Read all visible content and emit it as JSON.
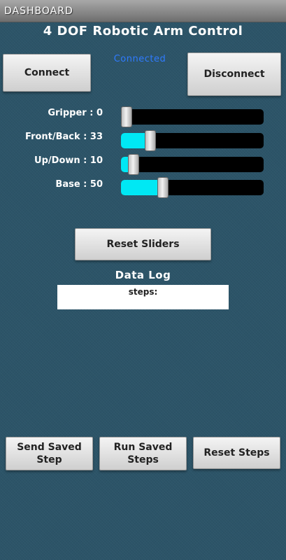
{
  "titlebar": {
    "title": "DASHBOARD"
  },
  "app_title": "4 DOF Robotic Arm Control",
  "connection": {
    "connect_label": "Connect",
    "disconnect_label": "Disconnect",
    "status_text": "Connected"
  },
  "sliders": [
    {
      "label": "Gripper : 0",
      "value": 0
    },
    {
      "label": "Front/Back : 33",
      "value": 33
    },
    {
      "label": "Up/Down : 10",
      "value": 10
    },
    {
      "label": "Base : 50",
      "value": 50
    }
  ],
  "reset_sliders_label": "Reset Sliders",
  "data_log": {
    "title": "Data Log",
    "content": "steps:"
  },
  "footer_buttons": {
    "send_saved_step": "Send Saved Step",
    "run_saved_steps": "Run Saved Steps",
    "reset_steps": "Reset Steps"
  },
  "colors": {
    "background": "#2c5468",
    "slider_fill": "#00e8f4",
    "status_text": "#2f7bff"
  }
}
